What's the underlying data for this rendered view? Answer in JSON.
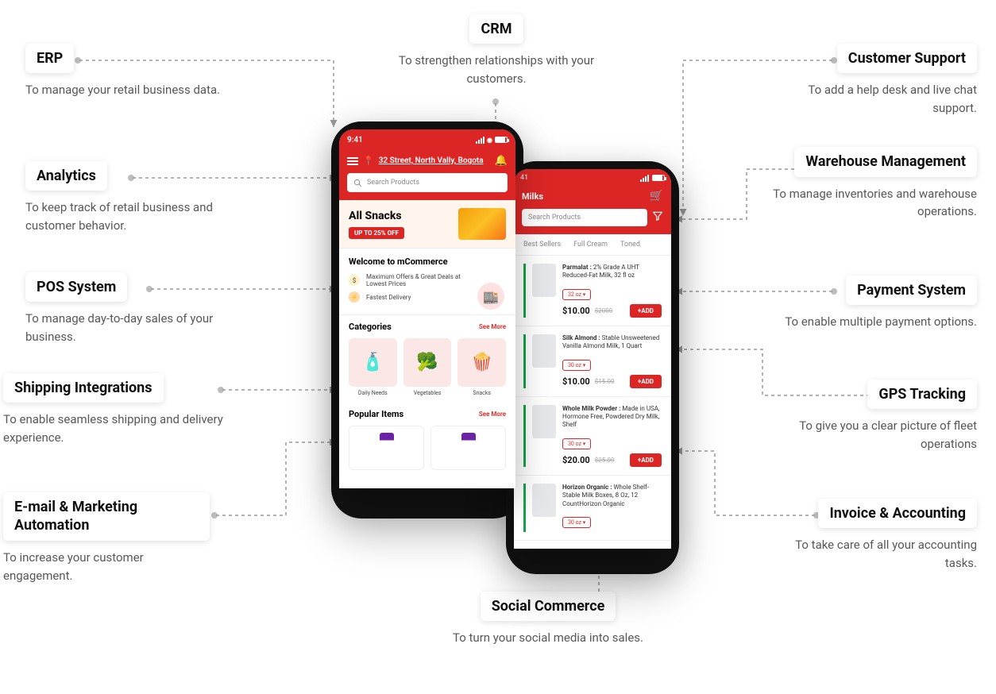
{
  "features": {
    "erp": {
      "title": "ERP",
      "desc": "To manage your retail business data."
    },
    "analytics": {
      "title": "Analytics",
      "desc": "To keep track of retail business and customer behavior."
    },
    "pos": {
      "title": "POS System",
      "desc": "To manage day-to-day sales of your business."
    },
    "shipping": {
      "title": "Shipping Integrations",
      "desc": "To enable seamless shipping and delivery experience."
    },
    "email": {
      "title": "E-mail & Marketing Automation",
      "desc": "To increase your customer engagement."
    },
    "crm": {
      "title": "CRM",
      "desc": "To strengthen relationships with your customers."
    },
    "social": {
      "title": "Social Commerce",
      "desc": "To turn your social media into sales."
    },
    "support": {
      "title": "Customer Support",
      "desc": "To add a help desk and live chat support."
    },
    "warehouse": {
      "title": "Warehouse Management",
      "desc": "To manage inventories and warehouse operations."
    },
    "payment": {
      "title": "Payment System",
      "desc": "To enable multiple payment options."
    },
    "gps": {
      "title": "GPS Tracking",
      "desc": "To give you a clear picture of fleet operations"
    },
    "invoice": {
      "title": "Invoice & Accounting",
      "desc": "To take care of all your accounting tasks."
    }
  },
  "phone1": {
    "time": "9:41",
    "address": "32 Street, North Vally, Bogota",
    "search_placeholder": "Search Products",
    "banner_title": "All Snacks",
    "banner_offer": "UP TO 25% OFF",
    "welcome_title": "Welcome to mCommerce",
    "welcome_line1": "Maximum Offers & Great Deals at Lowest Prices",
    "welcome_line2": "Fastest Delivery",
    "categories_title": "Categories",
    "see_more": "See More",
    "cat1": "Daily Needs",
    "cat2": "Vegetables",
    "cat3": "Snacks",
    "popular_title": "Popular Items"
  },
  "phone2": {
    "time": "41",
    "title": "Milks",
    "search_placeholder": "Search Products",
    "tab1": "Best Sellers",
    "tab2": "Full Cream",
    "tab3": "Toned",
    "products": [
      {
        "brand": "Parmalat :",
        "name": "2% Grade A UHT Reduced-Fat Milk, 32 fl oz",
        "size": "32 oz",
        "price": "$10.00",
        "oprice": "$2000",
        "btn": "+ADD"
      },
      {
        "brand": "Silk Almond :",
        "name": "Stable Unsweetened Vanilla Almond Milk, 1 Quart",
        "size": "30 oz",
        "price": "$10.00",
        "oprice": "$15.00",
        "btn": "+ADD"
      },
      {
        "brand": "Whole Milk Powder :",
        "name": "Made in USA, Hormone Free, Powdered Dry Milk, Shelf",
        "size": "30 oz",
        "price": "$20.00",
        "oprice": "$25.00",
        "btn": "+ADD"
      },
      {
        "brand": "Horizon Organic :",
        "name": "Whole Shelf-Stable Milk Boxes, 8 Oz, 12 CountHorizon Organic",
        "size": "30 oz",
        "price": "",
        "oprice": "",
        "btn": ""
      }
    ]
  }
}
